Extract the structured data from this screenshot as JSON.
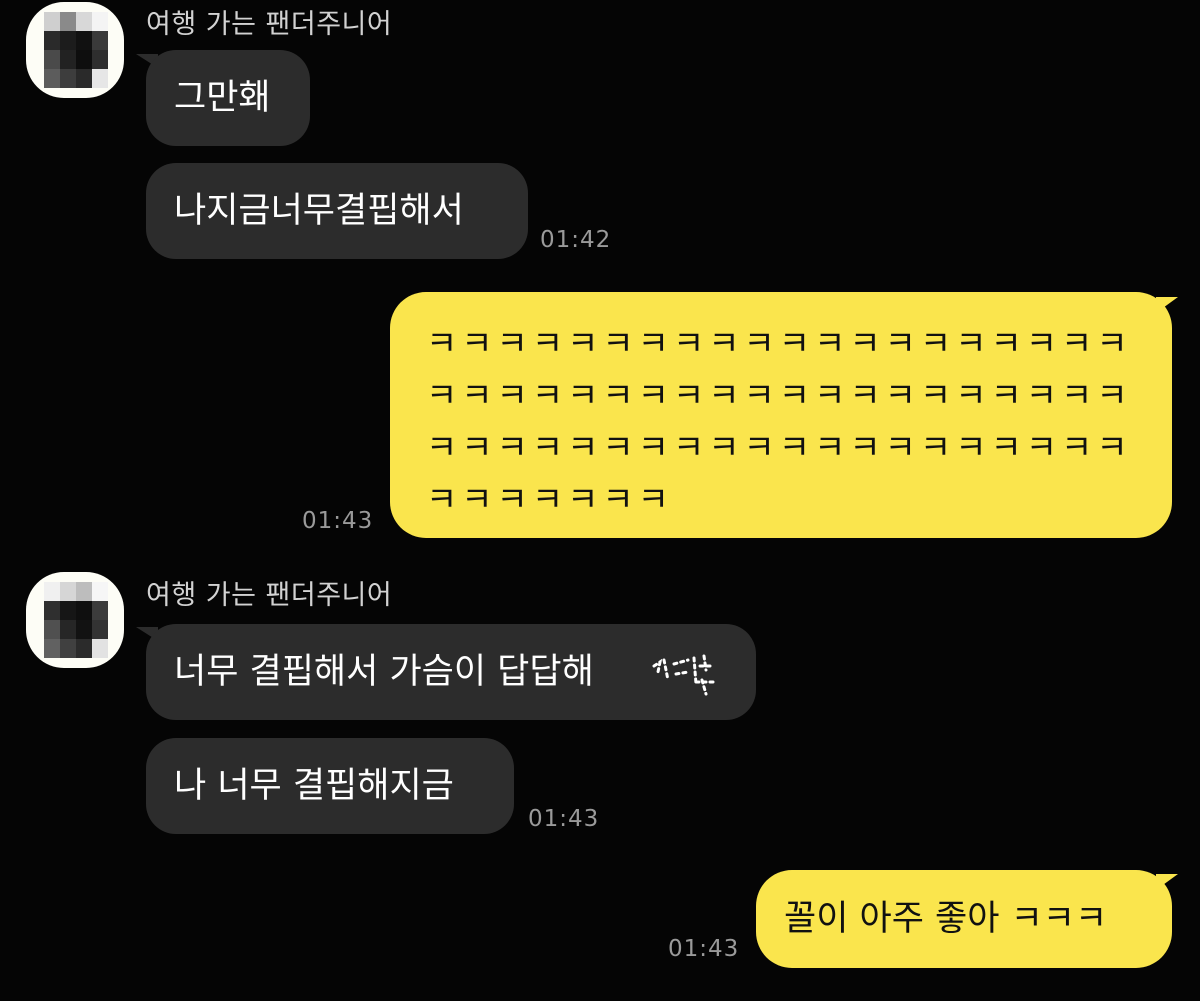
{
  "messages": [
    {
      "sender": "여행 가는 팬더주니어",
      "text": "그만홰"
    },
    {
      "sender": "",
      "text": "나지금너무결핍해서",
      "time": "01:42"
    },
    {
      "me": true,
      "text": "ㅋㅋㅋㅋㅋㅋㅋㅋㅋㅋㅋㅋㅋㅋㅋㅋㅋㅋㅋㅋ\nㅋㅋㅋㅋㅋㅋㅋㅋㅋㅋㅋㅋㅋㅋㅋㅋㅋㅋㅋㅋ\nㅋㅋㅋㅋㅋㅋㅋㅋㅋㅋㅋㅋㅋㅋㅋㅋㅋㅋㅋㅋ\nㅋㅋㅋㅋㅋㅋㅋ",
      "time": "01:43"
    },
    {
      "sender": "여행 가는 팬더주니어",
      "text": "너무 결핍해서 가슴이 답답해"
    },
    {
      "sender": "",
      "text": "나 너무 결핍해지금",
      "time": "01:43"
    },
    {
      "me": true,
      "text": "꼴이 아주 좋아 ㅋㅋㅋ",
      "time": "01:43"
    }
  ],
  "colors": {
    "background": "#050505",
    "incoming_bubble": "#2c2c2c",
    "outgoing_bubble": "#fae54d",
    "timestamp": "#9a9a9a"
  },
  "icons": {
    "avatar": "pixelated-avatar",
    "censored_word": "censored-scribble"
  }
}
